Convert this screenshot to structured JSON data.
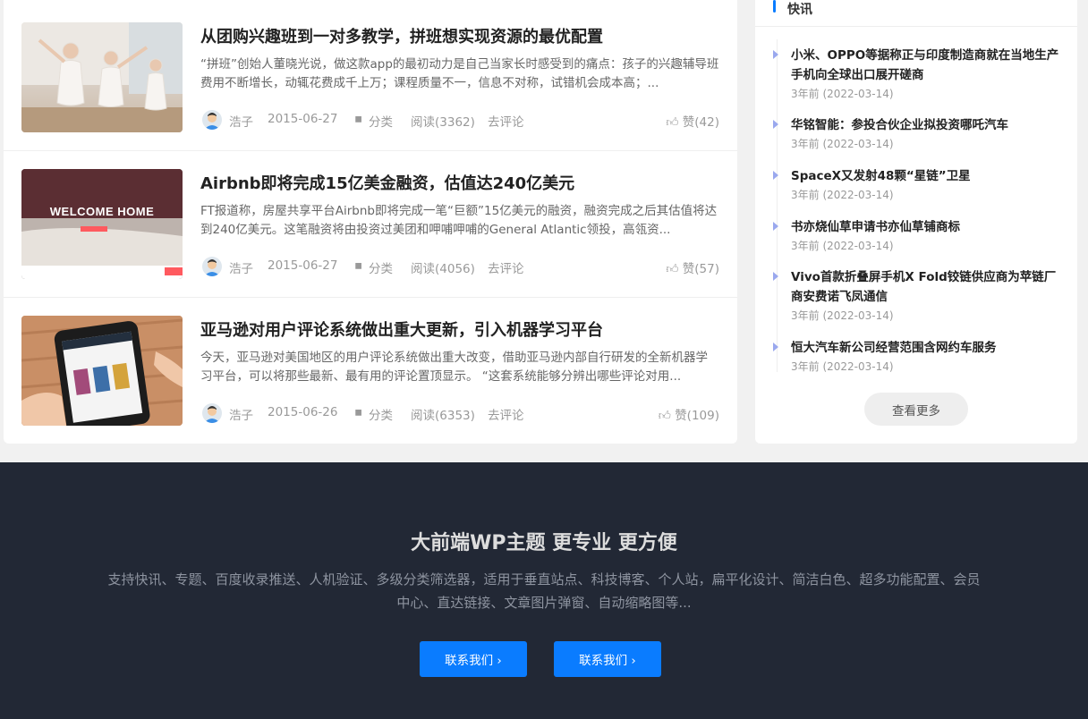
{
  "posts": [
    {
      "title": "从团购兴趣班到一对多教学，拼班想实现资源的最优配置",
      "excerpt": "“拼班”创始人董晓光说，做这款app的最初动力是自己当家长时感受到的痛点：孩子的兴趣辅导班费用不断增长，动辄花费成千上万；课程质量不一，信息不对称，试错机会成本高；...",
      "author": "浩子",
      "date": "2015-06-27",
      "category": "分类",
      "views": "阅读(3362)",
      "comment": "去评论",
      "likes": "赞(42)",
      "image": "ballet-class-photo"
    },
    {
      "title": "Airbnb即将完成15亿美金融资，估值达240亿美元",
      "excerpt": "FT报道称，房屋共享平台Airbnb即将完成一笔“巨额”15亿美元的融资，融资完成之后其估值将达到240亿美元。这笔融资将由投资过美团和呷哺呷哺的General Atlantic领投，高瓴资...",
      "author": "浩子",
      "date": "2015-06-27",
      "category": "分类",
      "views": "阅读(4056)",
      "comment": "去评论",
      "likes": "赞(57)",
      "image": "airbnb-welcome-home-photo",
      "image_text": "WELCOME HOME"
    },
    {
      "title": "亚马逊对用户评论系统做出重大更新，引入机器学习平台",
      "excerpt": "今天，亚马逊对美国地区的用户评论系统做出重大改变，借助亚马逊内部自行研发的全新机器学习平台，可以将那些最新、最有用的评论置顶显示。 “这套系统能够分辨出哪些评论对用...",
      "author": "浩子",
      "date": "2015-06-26",
      "category": "分类",
      "views": "阅读(6353)",
      "comment": "去评论",
      "likes": "赞(109)",
      "image": "amazon-phone-photo"
    }
  ],
  "sidebar": {
    "title": "快讯",
    "items": [
      {
        "title": "小米、OPPO等据称正与印度制造商就在当地生产手机向全球出口展开磋商",
        "time": "3年前 (2022-03-14)"
      },
      {
        "title": "华铭智能：参投合伙企业拟投资哪吒汽车",
        "time": "3年前 (2022-03-14)"
      },
      {
        "title": "SpaceX又发射48颗“星链”卫星",
        "time": "3年前 (2022-03-14)"
      },
      {
        "title": "书亦烧仙草申请书亦仙草铺商标",
        "time": "3年前 (2022-03-14)"
      },
      {
        "title": "Vivo首款折叠屏手机X Fold铰链供应商为苹链厂商安费诺飞凤通信",
        "time": "3年前 (2022-03-14)"
      },
      {
        "title": "恒大汽车新公司经营范围含网约车服务",
        "time": "3年前 (2022-03-14)"
      }
    ],
    "more_label": "查看更多"
  },
  "footer": {
    "title": "大前端WP主题 更专业 更方便",
    "description": "支持快讯、专题、百度收录推送、人机验证、多级分类筛选器，适用于垂直站点、科技博客、个人站，扁平化设计、简洁白色、超多功能配置、会员中心、直达链接、文章图片弹窗、自动缩略图等...",
    "button1": "联系我们 ›",
    "button2": "联系我们 ›"
  },
  "colors": {
    "accent": "#0a7cff",
    "footer_bg": "#222835",
    "page_bg": "#f1f1f1"
  }
}
